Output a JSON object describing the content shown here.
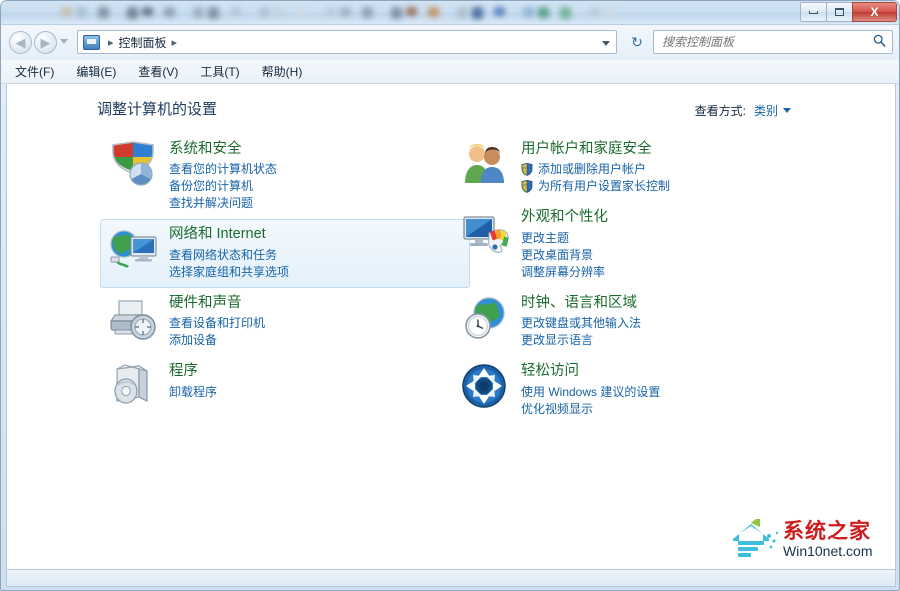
{
  "window": {
    "controls": {
      "minimize": "─",
      "maximize": "□",
      "close": "X"
    }
  },
  "navbar": {
    "back_icon": "◀",
    "forward_icon": "▶",
    "breadcrumb_root": "控制面板",
    "breadcrumb_sep": "▸",
    "refresh_icon": "↻",
    "search_placeholder": "搜索控制面板",
    "search_value": "",
    "search_icon": "⚲"
  },
  "menubar": {
    "items": [
      {
        "label": "文件(F)"
      },
      {
        "label": "编辑(E)"
      },
      {
        "label": "查看(V)"
      },
      {
        "label": "工具(T)"
      },
      {
        "label": "帮助(H)"
      }
    ]
  },
  "page": {
    "title": "调整计算机的设置",
    "viewby_label": "查看方式:",
    "viewby_value": "类别"
  },
  "categories_left": [
    {
      "id": "system-and-security",
      "icon": "shield-pie-icon",
      "title": "系统和安全",
      "hovered": false,
      "links": [
        {
          "label": "查看您的计算机状态",
          "shield": false
        },
        {
          "label": "备份您的计算机",
          "shield": false
        },
        {
          "label": "查找并解决问题",
          "shield": false
        }
      ]
    },
    {
      "id": "network-and-internet",
      "icon": "globe-monitor-icon",
      "title": "网络和 Internet",
      "hovered": true,
      "links": [
        {
          "label": "查看网络状态和任务",
          "shield": false
        },
        {
          "label": "选择家庭组和共享选项",
          "shield": false
        }
      ]
    },
    {
      "id": "hardware-and-sound",
      "icon": "printer-icon",
      "title": "硬件和声音",
      "hovered": false,
      "links": [
        {
          "label": "查看设备和打印机",
          "shield": false
        },
        {
          "label": "添加设备",
          "shield": false
        }
      ]
    },
    {
      "id": "programs",
      "icon": "programs-box-icon",
      "title": "程序",
      "hovered": false,
      "links": [
        {
          "label": "卸载程序",
          "shield": false
        }
      ]
    }
  ],
  "categories_right": [
    {
      "id": "user-accounts-and-family-safety",
      "icon": "users-icon",
      "title": "用户帐户和家庭安全",
      "hovered": false,
      "links": [
        {
          "label": "添加或删除用户帐户",
          "shield": true
        },
        {
          "label": "为所有用户设置家长控制",
          "shield": true
        }
      ]
    },
    {
      "id": "appearance-and-personalization",
      "icon": "monitor-palette-icon",
      "title": "外观和个性化",
      "hovered": false,
      "links": [
        {
          "label": "更改主题",
          "shield": false
        },
        {
          "label": "更改桌面背景",
          "shield": false
        },
        {
          "label": "调整屏幕分辨率",
          "shield": false
        }
      ]
    },
    {
      "id": "clock-language-and-region",
      "icon": "globe-clock-icon",
      "title": "时钟、语言和区域",
      "hovered": false,
      "links": [
        {
          "label": "更改键盘或其他输入法",
          "shield": false
        },
        {
          "label": "更改显示语言",
          "shield": false
        }
      ]
    },
    {
      "id": "ease-of-access",
      "icon": "ease-of-access-icon",
      "title": "轻松访问",
      "hovered": false,
      "links": [
        {
          "label": "使用 Windows 建议的设置",
          "shield": false
        },
        {
          "label": "优化视频显示",
          "shield": false
        }
      ]
    }
  ],
  "watermark": {
    "chinese": "系统之家",
    "english": "Win10net.com"
  },
  "colors": {
    "category_title": "#1d6a2e",
    "link": "#1763a8",
    "page_title": "#1b3a5c",
    "watermark_red": "#cf1b1b",
    "close_button": "#c0392b"
  }
}
